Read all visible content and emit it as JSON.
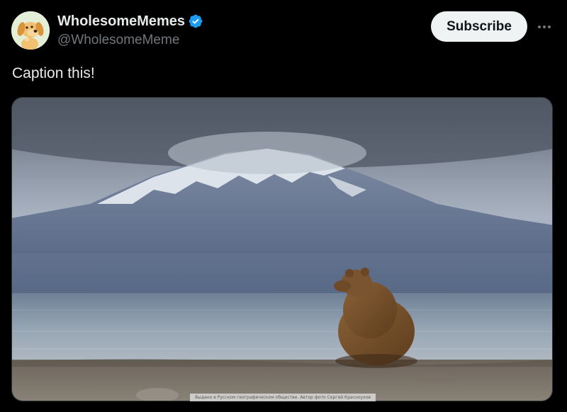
{
  "author": {
    "display_name": "WholesomeMemes",
    "handle": "@WholesomeMeme",
    "verified": true,
    "verified_icon": "verified-badge-icon",
    "avatar_icon": "cartoon-dog-avatar"
  },
  "actions": {
    "subscribe_label": "Subscribe",
    "more_icon": "more-horizontal-icon"
  },
  "post": {
    "text": "Caption this!"
  },
  "media": {
    "description_icon": "photo-bear-mountain",
    "credit_text": "Выдано в Русском географическом обществе. Автор фото Сергей Красноухов"
  },
  "colors": {
    "background": "#000000",
    "primary_text": "#e7e9ea",
    "secondary_text": "#71767b",
    "button_bg": "#eff3f4",
    "verified_blue": "#1d9bf0"
  }
}
